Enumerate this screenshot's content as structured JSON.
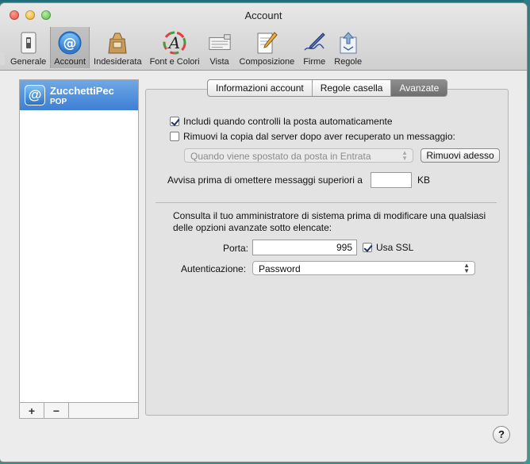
{
  "window": {
    "title": "Account"
  },
  "toolbar": {
    "items": [
      {
        "label": "Generale",
        "icon": "switch-icon"
      },
      {
        "label": "Account",
        "icon": "at-sign-icon",
        "selected": true
      },
      {
        "label": "Indesiderata",
        "icon": "junk-bag-icon"
      },
      {
        "label": "Font e Colori",
        "icon": "font-colors-icon"
      },
      {
        "label": "Vista",
        "icon": "view-icon"
      },
      {
        "label": "Composizione",
        "icon": "compose-pencil-icon"
      },
      {
        "label": "Firme",
        "icon": "signature-pen-icon"
      },
      {
        "label": "Regole",
        "icon": "rules-icon"
      }
    ]
  },
  "sidebar": {
    "accounts": [
      {
        "name": "ZucchettiPec",
        "type": "POP"
      }
    ],
    "add_label": "+",
    "remove_label": "−"
  },
  "tabs": [
    {
      "label": "Informazioni account"
    },
    {
      "label": "Regole casella"
    },
    {
      "label": "Avanzate",
      "active": true
    }
  ],
  "advanced": {
    "include_auto_check": {
      "label": "Includi quando controlli la posta automaticamente",
      "checked": true
    },
    "remove_copy": {
      "label": "Rimuovi la copia dal server dopo aver recuperato un messaggio:",
      "checked": false
    },
    "remove_when_select": {
      "value": "Quando viene spostato da posta in Entrata",
      "disabled": true
    },
    "remove_now_button": "Rimuovi adesso",
    "warn_label": "Avvisa prima di omettere messaggi superiori a",
    "warn_value": "",
    "warn_unit": "KB",
    "admin_note_line1": "Consulta il tuo amministratore di sistema prima di modificare una qualsiasi",
    "admin_note_line2": "delle opzioni avanzate sotto elencate:",
    "port_label": "Porta:",
    "port_value": "995",
    "ssl": {
      "label": "Usa SSL",
      "checked": true
    },
    "auth_label": "Autenticazione:",
    "auth_value": "Password"
  },
  "help_label": "?"
}
